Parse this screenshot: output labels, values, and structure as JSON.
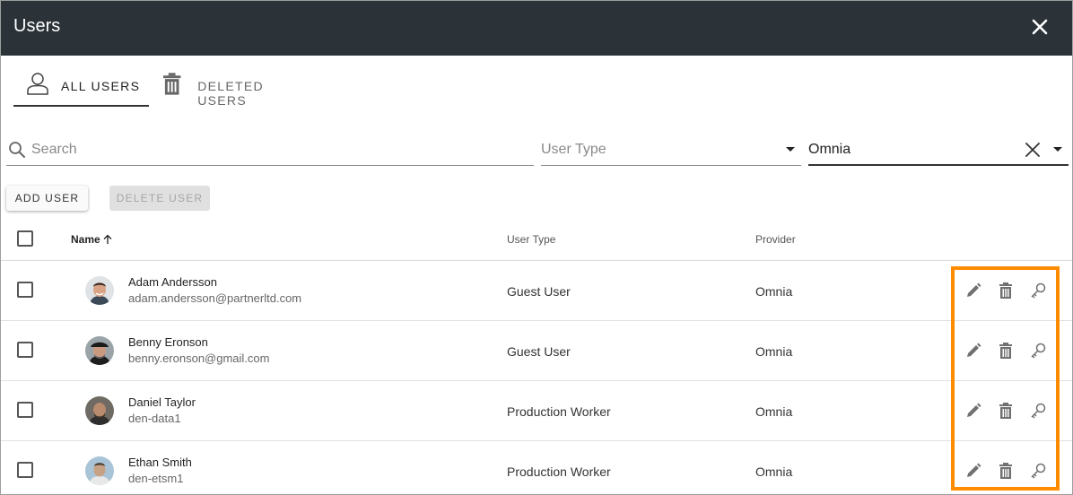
{
  "window": {
    "title": "Users",
    "close_icon": "close-icon"
  },
  "tabs": [
    {
      "label": "ALL USERS",
      "icon": "user-outline-icon",
      "active": true
    },
    {
      "label": "DELETED USERS",
      "icon": "trash-icon",
      "active": false
    }
  ],
  "filters": {
    "search": {
      "placeholder": "Search",
      "value": ""
    },
    "user_type": {
      "placeholder": "User Type",
      "value": ""
    },
    "provider": {
      "value": "Omnia"
    }
  },
  "toolbar": {
    "add_label": "ADD USER",
    "delete_label": "DELETE USER"
  },
  "table": {
    "columns": {
      "name": "Name",
      "user_type": "User Type",
      "provider": "Provider"
    },
    "sort": {
      "column": "Name",
      "direction": "ascending"
    },
    "rows": [
      {
        "name": "Adam Andersson",
        "email": "adam.andersson@partnerltd.com",
        "user_type": "Guest User",
        "provider": "Omnia"
      },
      {
        "name": "Benny Eronson",
        "email": "benny.eronson@gmail.com",
        "user_type": "Guest User",
        "provider": "Omnia"
      },
      {
        "name": "Daniel Taylor",
        "email": "den-data1",
        "user_type": "Production Worker",
        "provider": "Omnia"
      },
      {
        "name": "Ethan Smith",
        "email": "den-etsm1",
        "user_type": "Production Worker",
        "provider": "Omnia"
      }
    ],
    "row_actions": [
      "pencil-icon",
      "trash-icon",
      "key-icon"
    ]
  },
  "colors": {
    "header_bg": "#2b3339",
    "highlight": "#ff8c00",
    "text": "#222222"
  }
}
